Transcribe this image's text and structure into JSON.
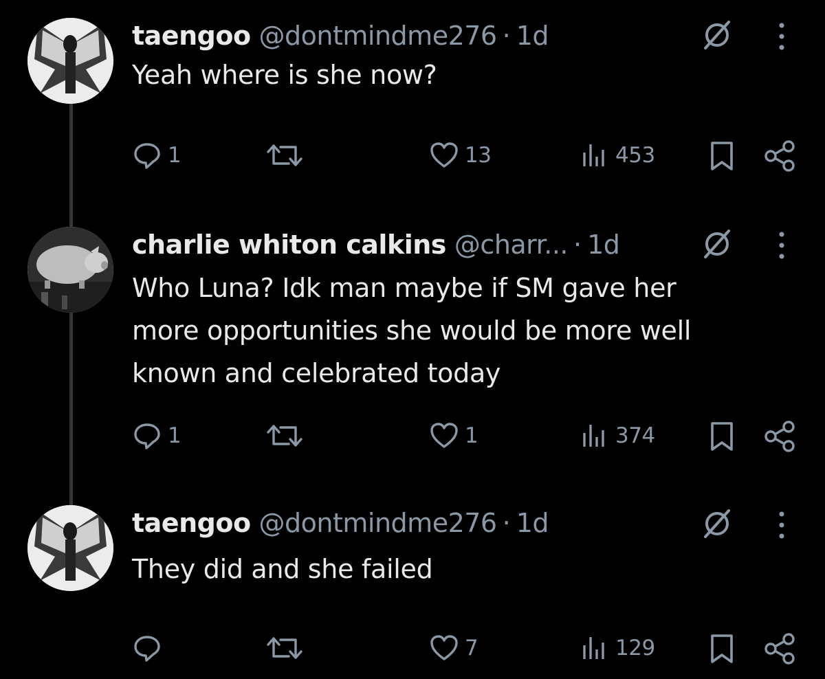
{
  "tweets": [
    {
      "name": "taengoo",
      "handle": "@dontmindme276",
      "sep": "·",
      "time": "1d",
      "text": [
        "Yeah where is she now?"
      ],
      "replies": "1",
      "reposts": "",
      "likes": "13",
      "views": "453",
      "avatar_icon": "avatar-butterfly-wings"
    },
    {
      "name": "charlie whiton calkins",
      "handle": "@charr...",
      "sep": "·",
      "time": "1d",
      "text": [
        "Who Luna? Idk man maybe if SM gave her",
        "more opportunities she would be more well",
        "known and celebrated today"
      ],
      "replies": "1",
      "reposts": "",
      "likes": "1",
      "views": "374",
      "avatar_icon": "avatar-pig"
    },
    {
      "name": "taengoo",
      "handle": "@dontmindme276",
      "sep": "·",
      "time": "1d",
      "text": [
        "They did and she failed"
      ],
      "replies": "",
      "reposts": "",
      "likes": "7",
      "views": "129",
      "avatar_icon": "avatar-butterfly-wings"
    }
  ],
  "colors": {
    "background": "#000000",
    "text": "#e7e9ea",
    "muted": "#8b98a5",
    "thread_line": "#333639"
  }
}
